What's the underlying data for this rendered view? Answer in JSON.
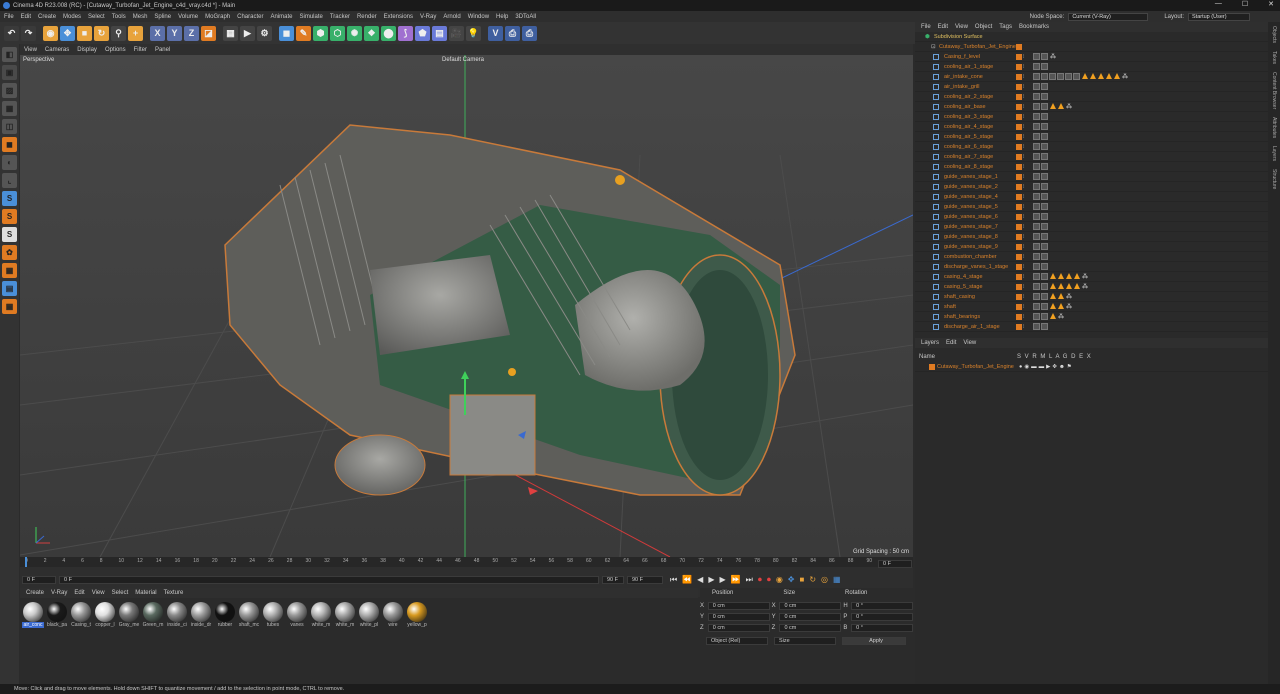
{
  "window": {
    "title": "Cinema 4D R23.008 (RC) - [Cutaway_Turbofan_Jet_Engine_c4d_vray.c4d *] - Main",
    "controls": [
      "—",
      "☐",
      "✕"
    ]
  },
  "menu": {
    "items": [
      "File",
      "Edit",
      "Create",
      "Modes",
      "Select",
      "Tools",
      "Mesh",
      "Spline",
      "Volume",
      "MoGraph",
      "Character",
      "Animate",
      "Simulate",
      "Tracker",
      "Render",
      "Extensions",
      "V-Ray",
      "Arnold",
      "Window",
      "Help",
      "3DToAll"
    ],
    "node_space_label": "Node Space:",
    "node_space_value": "Current (V-Ray)",
    "layout_label": "Layout:",
    "layout_value": "Startup (User)"
  },
  "toolbar": {
    "buttons": [
      {
        "name": "undo-icon",
        "glyph": "↶",
        "color": "#3a3a3a"
      },
      {
        "name": "redo-icon",
        "glyph": "↷",
        "color": "#3a3a3a"
      },
      {
        "name": "live-select-icon",
        "glyph": "◉",
        "color": "#e8a33c"
      },
      {
        "name": "move-icon",
        "glyph": "✥",
        "color": "#4a8fd8"
      },
      {
        "name": "scale-icon",
        "glyph": "■",
        "color": "#e8a33c"
      },
      {
        "name": "rotate-icon",
        "glyph": "↻",
        "color": "#e8a33c"
      },
      {
        "name": "recent-tools-icon",
        "glyph": "⚲",
        "color": "#444"
      },
      {
        "name": "add-icon",
        "glyph": "+",
        "color": "#e8a33c"
      },
      {
        "name": "x-axis-icon",
        "glyph": "X",
        "color": "#5b6fa8"
      },
      {
        "name": "y-axis-icon",
        "glyph": "Y",
        "color": "#5b6fa8"
      },
      {
        "name": "z-axis-icon",
        "glyph": "Z",
        "color": "#5b6fa8"
      },
      {
        "name": "coord-system-icon",
        "glyph": "◪",
        "color": "#e07b22"
      },
      {
        "name": "render-region-icon",
        "glyph": "▦",
        "color": "#444"
      },
      {
        "name": "render-view-icon",
        "glyph": "▶",
        "color": "#444"
      },
      {
        "name": "render-settings-icon",
        "glyph": "⚙",
        "color": "#444"
      },
      {
        "name": "cube-icon",
        "glyph": "◼",
        "color": "#4a8fd8"
      },
      {
        "name": "pen-icon",
        "glyph": "✎",
        "color": "#e07b22"
      },
      {
        "name": "subdivision-icon",
        "glyph": "⬢",
        "color": "#38b06a"
      },
      {
        "name": "array-icon",
        "glyph": "⬡",
        "color": "#38b06a"
      },
      {
        "name": "deformer-icon",
        "glyph": "✺",
        "color": "#38b06a"
      },
      {
        "name": "mograph-icon",
        "glyph": "❖",
        "color": "#38b06a"
      },
      {
        "name": "field-icon",
        "glyph": "⬤",
        "color": "#38b06a"
      },
      {
        "name": "bend-icon",
        "glyph": "⟆",
        "color": "#a070d0"
      },
      {
        "name": "scene-icon",
        "glyph": "⬟",
        "color": "#6a7ad8"
      },
      {
        "name": "floor-icon",
        "glyph": "▤",
        "color": "#6a7ad8"
      },
      {
        "name": "camera-icon",
        "glyph": "🎥",
        "color": "#444"
      },
      {
        "name": "light-icon",
        "glyph": "💡",
        "color": "#444"
      },
      {
        "name": "vray-icon",
        "glyph": "V",
        "color": "#3f5f9f"
      },
      {
        "name": "vray-render-icon",
        "glyph": "⎙",
        "color": "#3f5f9f"
      },
      {
        "name": "vray-ipr-icon",
        "glyph": "⎙",
        "color": "#3f5f9f"
      }
    ]
  },
  "lefttools": [
    "view-icon",
    "cube-persp-icon",
    "texture-icon",
    "points-icon",
    "edges-icon",
    "polygons-icon",
    "model-icon",
    "axis-icon",
    "snap-s-icon",
    "snap-s2-icon",
    "snap-s3-icon",
    "spin-icon",
    "grid-icon",
    "workplane-icon",
    "lock-icon"
  ],
  "viewport": {
    "menu": [
      "View",
      "Cameras",
      "Display",
      "Options",
      "Filter",
      "Panel"
    ],
    "label": "Perspective",
    "camera": "Default Camera",
    "grid_spacing": "Grid Spacing : 50 cm"
  },
  "timeline": {
    "ticks": [
      "0",
      "2",
      "4",
      "6",
      "8",
      "10",
      "12",
      "14",
      "16",
      "18",
      "20",
      "22",
      "24",
      "26",
      "28",
      "30",
      "32",
      "34",
      "36",
      "38",
      "40",
      "42",
      "44",
      "46",
      "48",
      "50",
      "52",
      "54",
      "56",
      "58",
      "60",
      "62",
      "64",
      "66",
      "68",
      "70",
      "72",
      "74",
      "76",
      "78",
      "80",
      "82",
      "84",
      "86",
      "88",
      "90"
    ],
    "current_frame": "0 F",
    "start_frame": "0 F",
    "min_field": "0 F",
    "end_field": "90 F",
    "max_field": "90 F",
    "frame_display": "0 F"
  },
  "materials": {
    "menu": [
      "Create",
      "V-Ray",
      "Edit",
      "View",
      "Select",
      "Material",
      "Texture"
    ],
    "items": [
      {
        "label": "air_conc",
        "color": "#c9c9c9"
      },
      {
        "label": "black_pa",
        "color": "#1a1a1a"
      },
      {
        "label": "Casing_t",
        "color": "#9a9a9a"
      },
      {
        "label": "copper_l",
        "color": "#e0e0e0"
      },
      {
        "label": "Gray_me",
        "color": "#7a7a7a"
      },
      {
        "label": "Green_m",
        "color": "#5a6a60"
      },
      {
        "label": "inside_ci",
        "color": "#8a8a8a"
      },
      {
        "label": "inside_dr",
        "color": "#a0a0a0"
      },
      {
        "label": "rubber",
        "color": "#111"
      },
      {
        "label": "shaft_mc",
        "color": "#9a9a9a"
      },
      {
        "label": "tubes",
        "color": "#b0b0b0"
      },
      {
        "label": "vanes",
        "color": "#9a9a9a"
      },
      {
        "label": "white_m",
        "color": "#b5b5b5"
      },
      {
        "label": "white_m",
        "color": "#a8a8a8"
      },
      {
        "label": "white_pl",
        "color": "#b0b0b0"
      },
      {
        "label": "wire",
        "color": "#9a9a9a"
      },
      {
        "label": "yellow_p",
        "color": "#d89a20"
      }
    ]
  },
  "coords": {
    "headers": [
      "Position",
      "Size",
      "Rotation"
    ],
    "rows": [
      {
        "axis": "X",
        "pos": "0 cm",
        "size_axis": "X",
        "size": "0 cm",
        "rot_axis": "H",
        "rot": "0 °"
      },
      {
        "axis": "Y",
        "pos": "0 cm",
        "size_axis": "Y",
        "size": "0 cm",
        "rot_axis": "P",
        "rot": "0 °"
      },
      {
        "axis": "Z",
        "pos": "0 cm",
        "size_axis": "Z",
        "size": "0 cm",
        "rot_axis": "B",
        "rot": "0 °"
      }
    ],
    "mode": "Object (Rel)",
    "size_mode": "Size",
    "apply": "Apply"
  },
  "objmgr": {
    "menu": [
      "File",
      "Edit",
      "View",
      "Object",
      "Tags",
      "Bookmarks"
    ],
    "root": "Subdivision Surface",
    "group": "Cutaway_Turbofan_Jet_Engine",
    "objects": [
      {
        "name": "Casing_f_level",
        "tags": 3
      },
      {
        "name": "cooling_air_1_stage",
        "tags": 2
      },
      {
        "name": "air_intake_cone",
        "tags": 12
      },
      {
        "name": "air_intake_grill",
        "tags": 2
      },
      {
        "name": "cooling_air_2_stage",
        "tags": 2
      },
      {
        "name": "cooling_air_base",
        "tags": 5
      },
      {
        "name": "cooling_air_3_stage",
        "tags": 2
      },
      {
        "name": "cooling_air_4_stage",
        "tags": 2
      },
      {
        "name": "cooling_air_5_stage",
        "tags": 2
      },
      {
        "name": "cooling_air_6_stage",
        "tags": 2
      },
      {
        "name": "cooling_air_7_stage",
        "tags": 2
      },
      {
        "name": "cooling_air_8_stage",
        "tags": 2
      },
      {
        "name": "guide_vanes_stage_1",
        "tags": 2
      },
      {
        "name": "guide_vanes_stage_2",
        "tags": 2
      },
      {
        "name": "guide_vanes_stage_4",
        "tags": 2
      },
      {
        "name": "guide_vanes_stage_5",
        "tags": 2
      },
      {
        "name": "guide_vanes_stage_6",
        "tags": 2
      },
      {
        "name": "guide_vanes_stage_7",
        "tags": 2
      },
      {
        "name": "guide_vanes_stage_8",
        "tags": 2
      },
      {
        "name": "guide_vanes_stage_9",
        "tags": 2
      },
      {
        "name": "combustion_chamber",
        "tags": 2
      },
      {
        "name": "discharge_vanes_1_stage",
        "tags": 2
      },
      {
        "name": "casing_4_stage",
        "tags": 7
      },
      {
        "name": "casing_5_stage",
        "tags": 7
      },
      {
        "name": "shaft_casing",
        "tags": 5
      },
      {
        "name": "shaft",
        "tags": 5
      },
      {
        "name": "shaft_bearings",
        "tags": 4
      },
      {
        "name": "discharge_air_1_stage",
        "tags": 2
      }
    ]
  },
  "layers": {
    "menu": [
      "Layers",
      "Edit",
      "View"
    ],
    "col_name": "Name",
    "cols": "S V R M L A G D E X",
    "layer": "Cutaway_Turbofan_Jet_Engine"
  },
  "right_tabs": [
    "Objects",
    "Takes",
    "Content Browser",
    "Attributes",
    "Layers",
    "Structure"
  ],
  "status": "Move: Click and drag to move elements. Hold down SHIFT to quantize movement / add to the selection in point mode, CTRL to remove."
}
